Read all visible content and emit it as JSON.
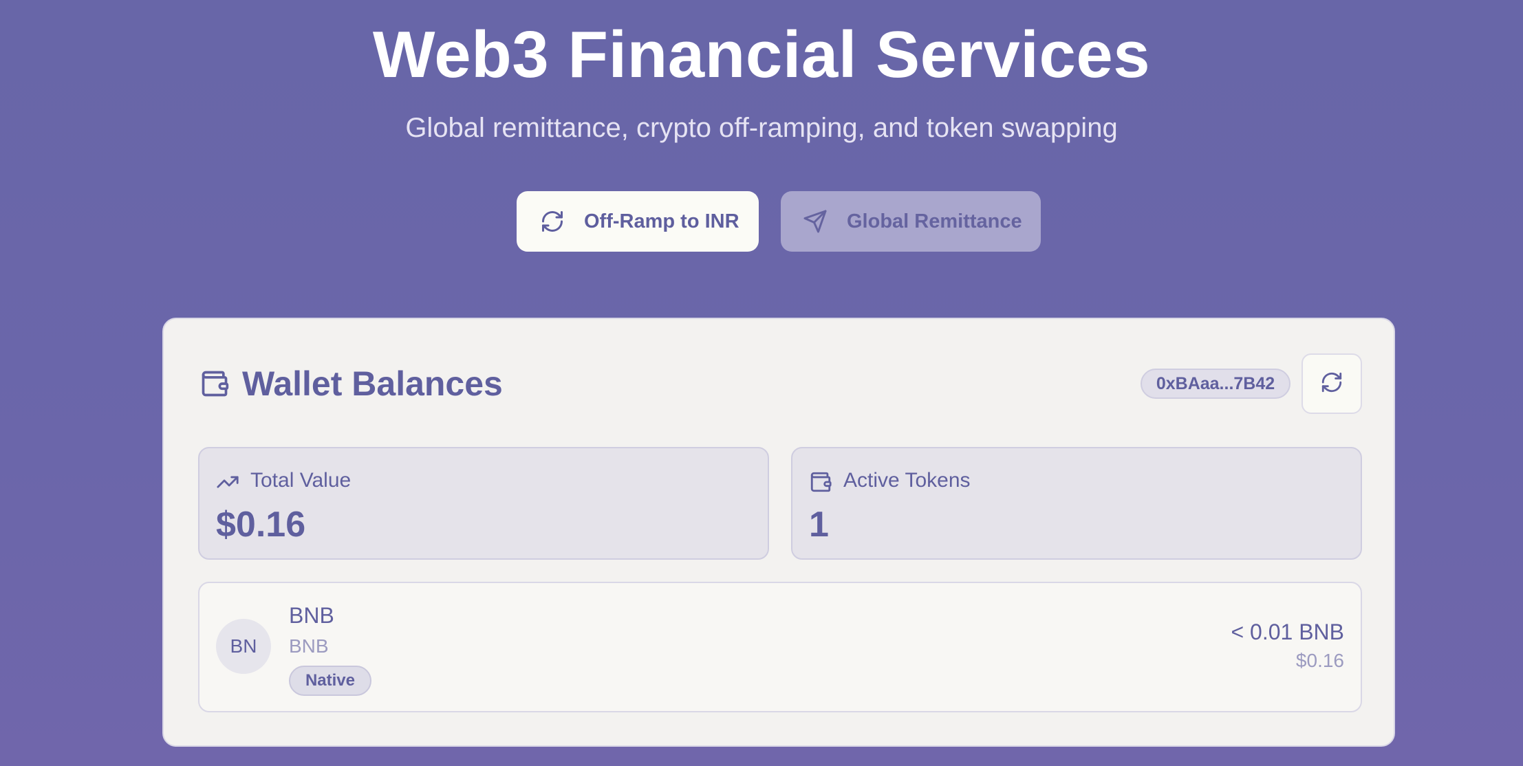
{
  "header": {
    "title": "Web3 Financial Services",
    "subtitle": "Global remittance, crypto off-ramping, and token swapping"
  },
  "modes": [
    {
      "label": "Off-Ramp to INR",
      "icon": "refresh-icon",
      "active": true
    },
    {
      "label": "Global Remittance",
      "icon": "send-icon",
      "active": false
    }
  ],
  "wallet": {
    "title": "Wallet Balances",
    "icon": "wallet-icon",
    "address": "0xBAaa...7B42",
    "refresh_icon": "refresh-icon",
    "stats": [
      {
        "label": "Total Value",
        "value": "$0.16",
        "icon": "trending-up-icon"
      },
      {
        "label": "Active Tokens",
        "value": "1",
        "icon": "wallet-icon"
      }
    ],
    "tokens": [
      {
        "avatar": "BN",
        "name": "BNB",
        "symbol": "BNB",
        "badge": "Native",
        "amount": "< 0.01 BNB",
        "usd": "$0.16"
      }
    ]
  },
  "colors": {
    "background": "#6b66aa",
    "accent": "#5f5f9e",
    "card": "#f3f2f0"
  }
}
